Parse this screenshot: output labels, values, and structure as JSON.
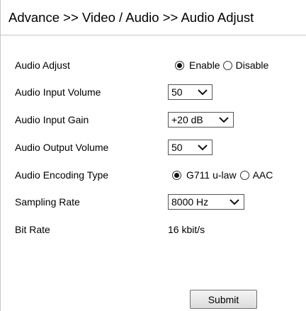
{
  "header": {
    "title": "Advance >> Video / Audio >> Audio Adjust"
  },
  "rows": {
    "audio_adjust": {
      "label": "Audio Adjust",
      "options": [
        "Enable",
        "Disable"
      ],
      "selected": "Enable"
    },
    "input_volume": {
      "label": "Audio Input Volume",
      "value": "50"
    },
    "input_gain": {
      "label": "Audio Input Gain",
      "value": "+20 dB"
    },
    "output_volume": {
      "label": "Audio Output Volume",
      "value": "50"
    },
    "encoding_type": {
      "label": "Audio Encoding Type",
      "options": [
        "G711 u-law",
        "AAC"
      ],
      "selected": "G711 u-law"
    },
    "sampling_rate": {
      "label": "Sampling Rate",
      "value": "8000 Hz"
    },
    "bit_rate": {
      "label": "Bit Rate",
      "value": "16 kbit/s"
    }
  },
  "actions": {
    "submit_label": "Submit"
  },
  "icons": {
    "dropdown": "chevron-down-icon",
    "radio_selected": "radio-selected-icon",
    "radio_unselected": "radio-unselected-icon"
  }
}
